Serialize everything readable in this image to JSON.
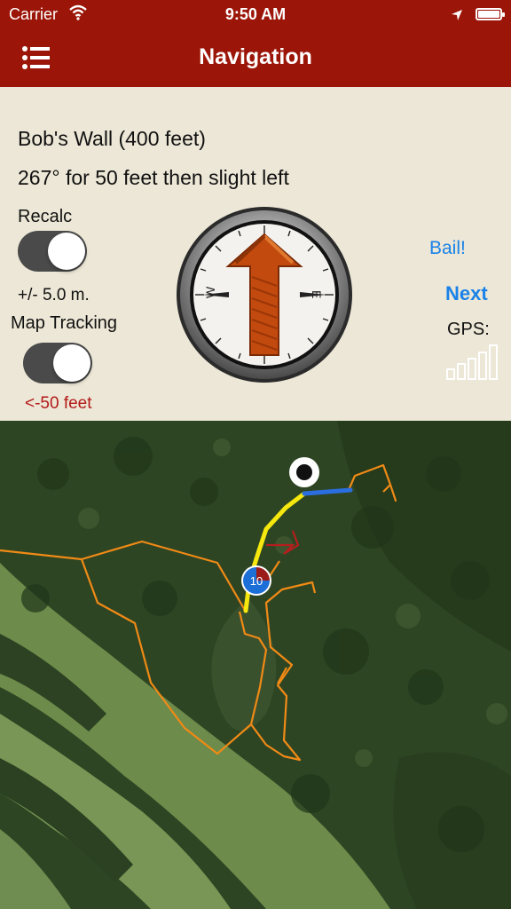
{
  "status_bar": {
    "carrier": "Carrier",
    "time": "9:50 AM"
  },
  "nav": {
    "title": "Navigation"
  },
  "panel": {
    "destination": "Bob's Wall (400 feet)",
    "instruction": "267° for 50 feet then slight left",
    "recalc_label": "Recalc",
    "recalc_on": true,
    "accuracy": "+/- 5.0 m.",
    "map_tracking_label": "Map Tracking",
    "map_tracking_on": true,
    "offtrack": "<-50 feet",
    "bail_label": "Bail!",
    "next_label": "Next",
    "gps_label": "GPS:",
    "gps_signal_bars": 5,
    "compass_letters": {
      "west": "W",
      "east": "E"
    }
  },
  "map": {
    "waypoint_number": "10"
  },
  "colors": {
    "header": "#9b1508",
    "panel_bg": "#ece7d6",
    "link": "#1a82e8",
    "warning": "#b31919",
    "trail": "#f08a16",
    "route": "#f6e80e",
    "route_next": "#2a6ee0"
  }
}
